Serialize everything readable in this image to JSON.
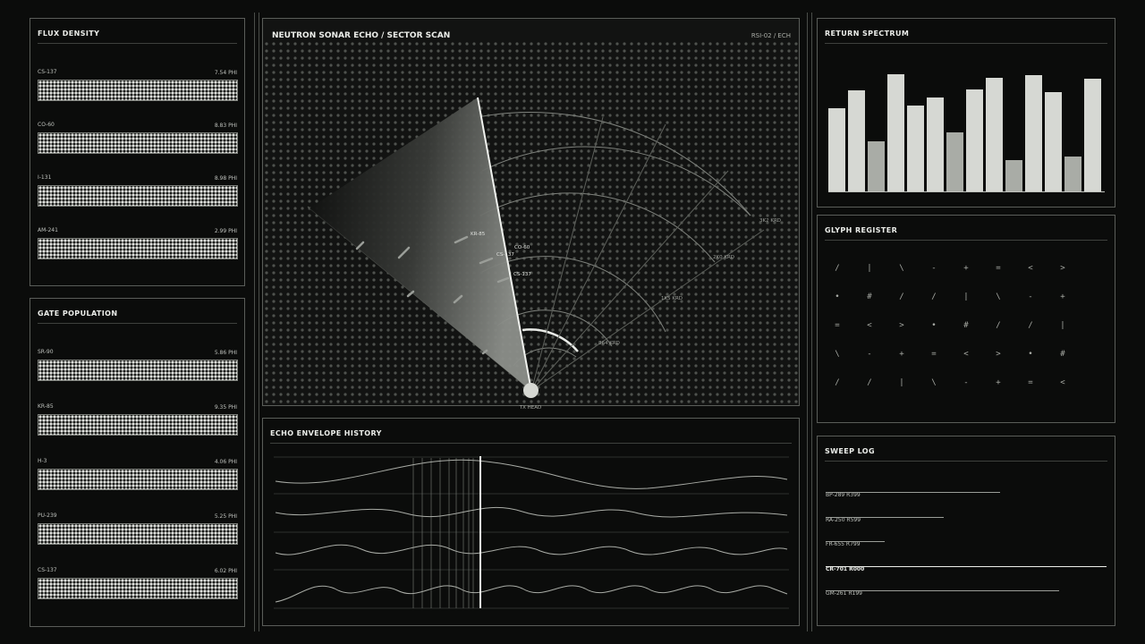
{
  "flux_density": {
    "title": "FLUX DENSITY",
    "items": [
      {
        "label": "CS-137",
        "value": "7.54 PHI"
      },
      {
        "label": "CO-60",
        "value": "8.83 PHI"
      },
      {
        "label": "I-131",
        "value": "8.98 PHI"
      },
      {
        "label": "AM-241",
        "value": "2.99 PHI"
      }
    ]
  },
  "gate_population": {
    "title": "GATE POPULATION",
    "items": [
      {
        "label": "SR-90",
        "value": "5.86 PHI"
      },
      {
        "label": "KR-85",
        "value": "9.35 PHI"
      },
      {
        "label": "H-3",
        "value": "4.06 PHI"
      },
      {
        "label": "PU-239",
        "value": "5.25 PHI"
      },
      {
        "label": "CS-137",
        "value": "6.02 PHI"
      }
    ]
  },
  "scan": {
    "title": "NEUTRON SONAR ECHO / SECTOR SCAN",
    "code": "RSI-02 / ECH",
    "tx_label": "TX HEAD",
    "range_labels": [
      "864 KRD",
      "1K5 KRD",
      "2K0 KRD",
      "3K2 KRD"
    ],
    "targets": [
      "KR-85",
      "CO-60",
      "CS-137",
      "CS-137"
    ]
  },
  "echo_history": {
    "title": "ECHO ENVELOPE HISTORY"
  },
  "return_spectrum": {
    "title": "RETURN SPECTRUM",
    "values": [
      0.71,
      0.86,
      0.43,
      1.0,
      0.73,
      0.8,
      0.5,
      0.87,
      0.97,
      0.27,
      0.99,
      0.85,
      0.3,
      0.96
    ]
  },
  "glyph_register": {
    "title": "GLYPH REGISTER",
    "rows": [
      [
        "/",
        "|",
        "\\",
        "-",
        "+",
        "=",
        "<",
        ">"
      ],
      [
        "•",
        "#",
        "/",
        "/",
        "|",
        "\\",
        "-",
        "+"
      ],
      [
        "=",
        "<",
        ">",
        "•",
        "#",
        "/",
        "/",
        "|"
      ],
      [
        "\\",
        "-",
        "+",
        "=",
        "<",
        ">",
        "•",
        "#"
      ],
      [
        "/",
        "/",
        "|",
        "\\",
        "-",
        "+",
        "=",
        "<"
      ]
    ]
  },
  "sweep_log": {
    "title": "SWEEP LOG",
    "items": [
      {
        "text": "BP-289 R399",
        "level": 0.62
      },
      {
        "text": "RA-250 R599",
        "level": 0.42
      },
      {
        "text": "FR-655 R799",
        "level": 0.21
      },
      {
        "text": "CR-701 R000",
        "level": 1.0
      },
      {
        "text": "GM-261 R199",
        "level": 0.83
      }
    ]
  },
  "colors": {
    "background": "#0b0c0b",
    "border": "#5a5d59",
    "text": "#eceeea",
    "bar_bright": "#d6d8d3",
    "bar_dim": "#a9aca6"
  }
}
